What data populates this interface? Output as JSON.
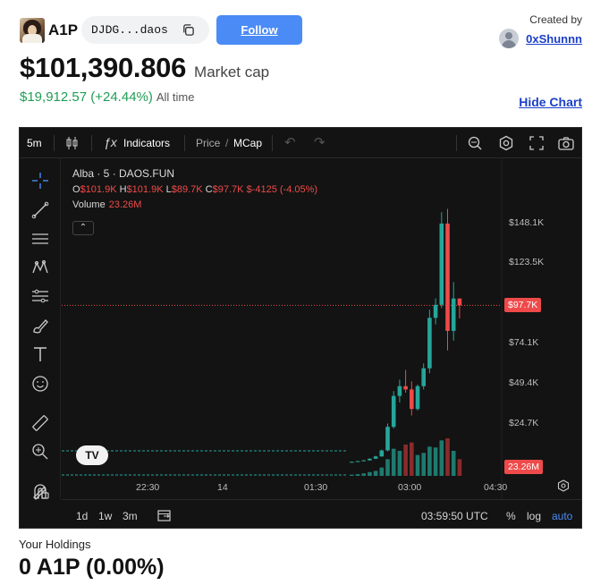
{
  "header": {
    "ticker": "A1P",
    "address_short": "DJDG...daos",
    "follow_label": "Follow",
    "created_by_label": "Created by",
    "creator_name": "0xShunnn"
  },
  "market": {
    "market_cap": "$101,390.806",
    "market_cap_label": "Market cap",
    "change": "$19,912.57 (+24.44%)",
    "change_period": "All time",
    "hide_chart_label": "Hide Chart"
  },
  "chart_toolbar": {
    "interval": "5m",
    "indicators_label": "Indicators",
    "price_label": "Price",
    "divider": "/",
    "mcap_label": "MCap"
  },
  "chart_legend": {
    "title": "Alba · 5 · DAOS.FUN",
    "o_key": "O",
    "o_val": "$101.9K",
    "h_key": "H",
    "h_val": "$101.9K",
    "l_key": "L",
    "l_val": "$89.7K",
    "c_key": "C",
    "c_val": "$97.7K",
    "change": "$-4125 (-4.05%)",
    "volume_label": "Volume",
    "volume_val": "23.26M"
  },
  "bottom_bar": {
    "range_1d": "1d",
    "range_1w": "1w",
    "range_3m": "3m",
    "time": "03:59:50 UTC",
    "percent": "%",
    "log": "log",
    "auto": "auto"
  },
  "holdings": {
    "label": "Your Holdings",
    "value": "0 A1P (0.00%)"
  },
  "colors": {
    "up": "#26a69a",
    "down": "#ef4a4a",
    "link": "#1c3fc7",
    "follow_bg": "#4b8bf5",
    "positive_change": "#1f9d55"
  },
  "chart_data": {
    "type": "candlestick",
    "y_unit": "USD market cap",
    "y_ticks": [
      "$148.1K",
      "$123.5K",
      "$74.1K",
      "$49.4K",
      "$24.7K"
    ],
    "ylim": [
      0,
      165000
    ],
    "current_value_label": "$97.7K",
    "current_value": 97700,
    "volume_tag": "23.26M",
    "x_ticks": [
      "22:30",
      "14",
      "01:30",
      "03:00",
      "04:30"
    ],
    "candles": [
      {
        "o": 1500,
        "h": 1600,
        "l": 1400,
        "c": 1500
      },
      {
        "o": 1500,
        "h": 2000,
        "l": 1400,
        "c": 1900
      },
      {
        "o": 1900,
        "h": 2600,
        "l": 1800,
        "c": 2400
      },
      {
        "o": 2400,
        "h": 3600,
        "l": 2300,
        "c": 3400
      },
      {
        "o": 3400,
        "h": 5200,
        "l": 3200,
        "c": 4800
      },
      {
        "o": 4800,
        "h": 9000,
        "l": 4600,
        "c": 8500
      },
      {
        "o": 8500,
        "h": 25000,
        "l": 8000,
        "c": 23000
      },
      {
        "o": 23000,
        "h": 45000,
        "l": 22000,
        "c": 42000
      },
      {
        "o": 42000,
        "h": 52000,
        "l": 38000,
        "c": 48000
      },
      {
        "o": 48000,
        "h": 58000,
        "l": 44000,
        "c": 46000
      },
      {
        "o": 46000,
        "h": 51000,
        "l": 30000,
        "c": 34000
      },
      {
        "o": 34000,
        "h": 49000,
        "l": 33000,
        "c": 48000
      },
      {
        "o": 48000,
        "h": 62000,
        "l": 46000,
        "c": 59000
      },
      {
        "o": 59000,
        "h": 95000,
        "l": 56000,
        "c": 90000
      },
      {
        "o": 90000,
        "h": 102000,
        "l": 86000,
        "c": 98000
      },
      {
        "o": 98000,
        "h": 155000,
        "l": 96000,
        "c": 148000
      },
      {
        "o": 148000,
        "h": 157000,
        "l": 70000,
        "c": 82000
      },
      {
        "o": 82000,
        "h": 112000,
        "l": 76000,
        "c": 101900
      },
      {
        "o": 101900,
        "h": 101900,
        "l": 89700,
        "c": 97700
      }
    ],
    "volumes": [
      0.3,
      0.4,
      0.6,
      0.9,
      1.2,
      2.0,
      4.0,
      6.5,
      6.0,
      7.5,
      8.0,
      5.0,
      5.5,
      7.0,
      6.8,
      8.5,
      9.0,
      6.0,
      4.0
    ],
    "volume_dir": [
      "up",
      "up",
      "up",
      "up",
      "up",
      "up",
      "up",
      "up",
      "up",
      "down",
      "down",
      "up",
      "up",
      "up",
      "up",
      "up",
      "down",
      "up",
      "down"
    ]
  }
}
